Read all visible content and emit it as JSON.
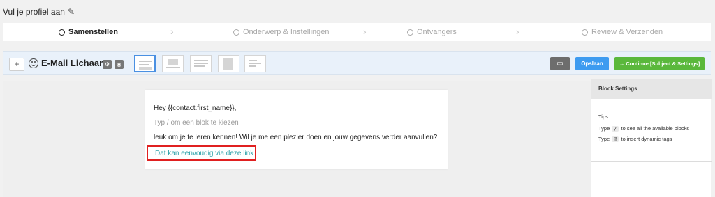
{
  "page": {
    "title": "Vul je profiel aan"
  },
  "steps": [
    {
      "label": "Samenstellen",
      "active": true
    },
    {
      "label": "Onderwerp & Instellingen",
      "active": false
    },
    {
      "label": "Ontvangers",
      "active": false
    },
    {
      "label": "Review & Verzenden",
      "active": false
    }
  ],
  "toolbar": {
    "add_label": "+",
    "email_title": "E-Mail Lichaam",
    "save_label": "Opslaan",
    "continue_label": "→ Continue [Subject & Settings]"
  },
  "email": {
    "greeting": "Hey {{contact.first_name}},",
    "placeholder": "Typ / om een blok te kiezen",
    "body": "leuk om je te leren kennen! Wil je me een plezier doen en jouw gegevens verder aanvullen?",
    "link_text": "Dat kan eenvoudig via deze link"
  },
  "settings": {
    "header": "Block Settings",
    "tips_label": "Tips:",
    "tips": [
      {
        "pre": "Type",
        "key": "/",
        "post": "to see all the available blocks"
      },
      {
        "pre": "Type",
        "key": "@",
        "post": "to insert dynamic tags"
      }
    ]
  },
  "colors": {
    "accent_blue": "#3d9bf0",
    "continue_green": "#5ab83c",
    "link_teal": "#2aa0a8",
    "highlight_red": "#e02020"
  }
}
